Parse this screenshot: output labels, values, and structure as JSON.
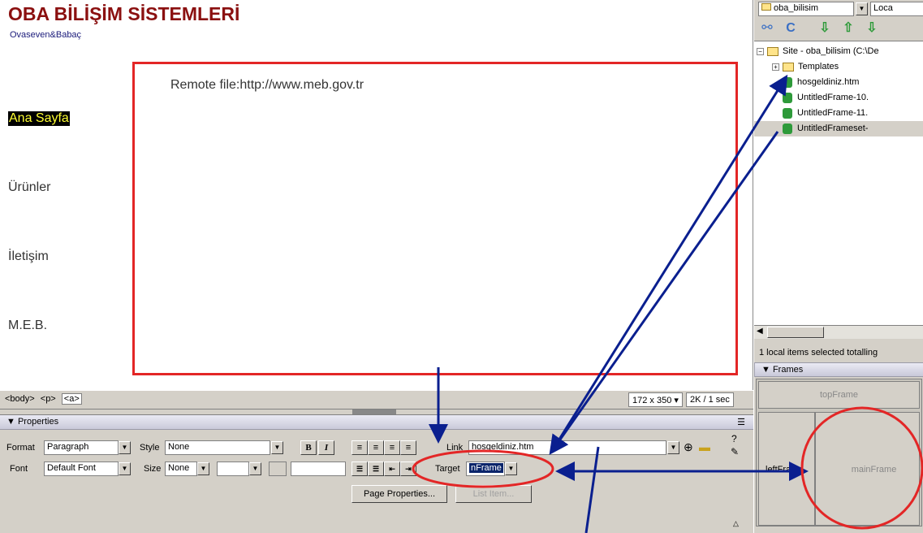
{
  "design": {
    "site_title": "OBA BİLİŞİM SİSTEMLERİ",
    "site_subtitle": "Ovaseven&Babaç",
    "nav": [
      "Ana Sayfa",
      "Ürünler",
      "İletişim",
      "M.E.B."
    ],
    "remote_file": "Remote file:http://www.meb.gov.tr"
  },
  "statusbar": {
    "tags": [
      "<body>",
      "<p>",
      "<a>"
    ],
    "window_size": "172 x 350",
    "download": "2K / 1 sec"
  },
  "properties": {
    "title": "Properties",
    "format_label": "Format",
    "format_value": "Paragraph",
    "style_label": "Style",
    "style_value": "None",
    "font_label": "Font",
    "font_value": "Default Font",
    "size_label": "Size",
    "size_value": "None",
    "bold": "B",
    "italic": "I",
    "link_label": "Link",
    "link_value": "hosgeldiniz.htm",
    "target_label": "Target",
    "target_value": "nFrame",
    "page_properties_button": "Page Properties...",
    "list_item_button": "List Item..."
  },
  "files_panel": {
    "site_combo": "oba_bilisim",
    "view_combo": "Loca",
    "tree": [
      {
        "label": "Site - oba_bilisim (C:\\De",
        "type": "site"
      },
      {
        "label": "Templates",
        "type": "folder"
      },
      {
        "label": "hosgeldiniz.htm",
        "type": "file"
      },
      {
        "label": "UntitledFrame-10.",
        "type": "file"
      },
      {
        "label": "UntitledFrame-11.",
        "type": "file"
      },
      {
        "label": "UntitledFrameset-",
        "type": "file"
      }
    ],
    "status": "1 local items selected totalling"
  },
  "frames_panel": {
    "title": "Frames",
    "top": "topFrame",
    "left": "leftFrame",
    "main": "mainFrame"
  },
  "colors": {
    "annotation_red": "#e32626",
    "annotation_arrow": "#0a1f8f",
    "title_red": "#8b1010"
  }
}
